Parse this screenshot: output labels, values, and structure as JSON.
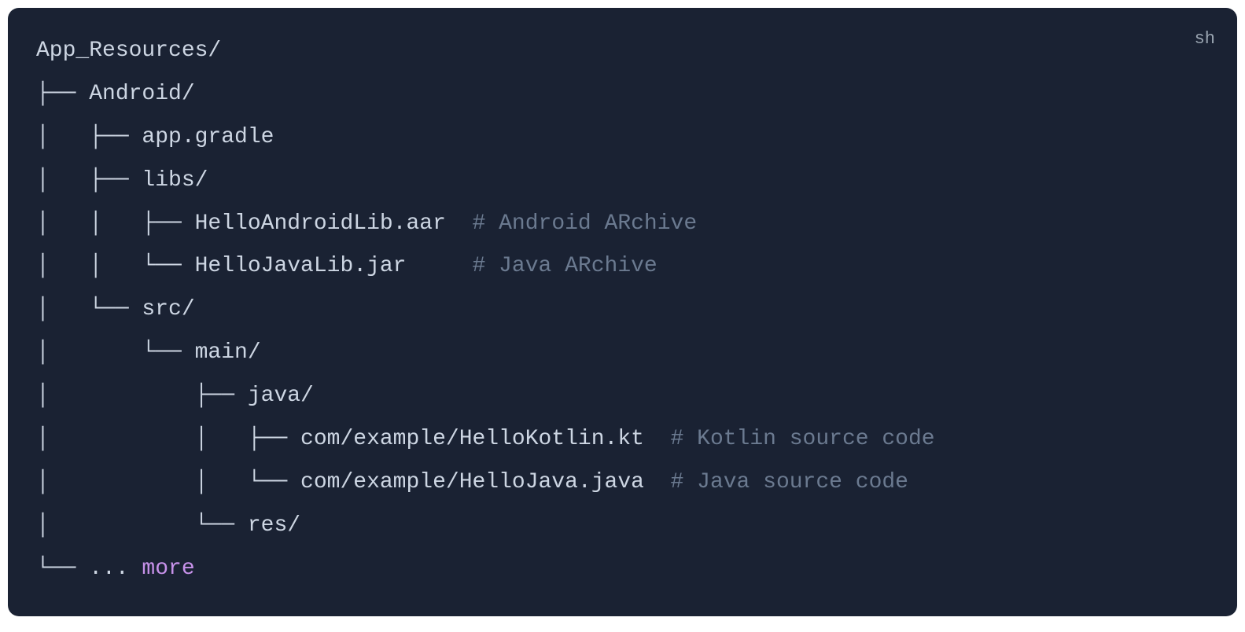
{
  "language_badge": "sh",
  "lines": [
    [
      {
        "cls": "token-text",
        "text": "App_Resources/"
      }
    ],
    [
      {
        "cls": "token-text",
        "text": "├── Android/"
      }
    ],
    [
      {
        "cls": "token-text",
        "text": "│   ├── app.gradle"
      }
    ],
    [
      {
        "cls": "token-text",
        "text": "│   ├── libs/"
      }
    ],
    [
      {
        "cls": "token-text",
        "text": "│   │   ├── HelloAndroidLib.aar  "
      },
      {
        "cls": "token-comment",
        "text": "# Android ARchive"
      }
    ],
    [
      {
        "cls": "token-text",
        "text": "│   │   └── HelloJavaLib.jar     "
      },
      {
        "cls": "token-comment",
        "text": "# Java ARchive"
      }
    ],
    [
      {
        "cls": "token-text",
        "text": "│   └── src/"
      }
    ],
    [
      {
        "cls": "token-text",
        "text": "│       └── main/"
      }
    ],
    [
      {
        "cls": "token-text",
        "text": "│           ├── java/"
      }
    ],
    [
      {
        "cls": "token-text",
        "text": "│           │   ├── com/example/HelloKotlin.kt  "
      },
      {
        "cls": "token-comment",
        "text": "# Kotlin source code"
      }
    ],
    [
      {
        "cls": "token-text",
        "text": "│           │   └── com/example/HelloJava.java  "
      },
      {
        "cls": "token-comment",
        "text": "# Java source code"
      }
    ],
    [
      {
        "cls": "token-text",
        "text": "│           └── res/"
      }
    ],
    [
      {
        "cls": "token-text",
        "text": "└── ... "
      },
      {
        "cls": "token-link",
        "text": "more"
      }
    ]
  ]
}
